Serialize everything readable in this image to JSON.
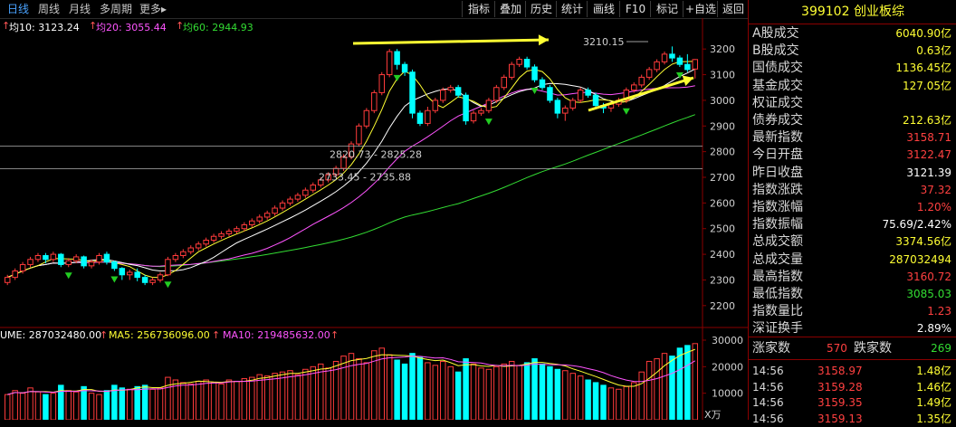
{
  "period_tabs": [
    {
      "label": "日线",
      "active": true
    },
    {
      "label": "周线",
      "active": false
    },
    {
      "label": "月线",
      "active": false
    },
    {
      "label": "多周期",
      "active": false
    },
    {
      "label": "更多▸",
      "active": false
    }
  ],
  "toolbar": [
    "指标",
    "叠加",
    "历史",
    "统计",
    "画线",
    "F10",
    "标记",
    "+自选",
    "返回"
  ],
  "ma_legend": [
    {
      "label": "均10: 3123.24",
      "color": "#ffffff"
    },
    {
      "label": "均20: 3055.44",
      "color": "#ff55ff"
    },
    {
      "label": "均60: 2944.93",
      "color": "#33dd33"
    }
  ],
  "price_axis": [
    "3200",
    "3100",
    "3000",
    "2900",
    "2800",
    "2700",
    "2600",
    "2500",
    "2400",
    "2300",
    "2200"
  ],
  "annotations": {
    "peak": "3210.15",
    "line1": "2820.73 - 2825.28",
    "line2": "2733.45 - 2735.88"
  },
  "volume_legend": [
    {
      "label": "UME: 287032480.00",
      "color": "#ffffff"
    },
    {
      "label": "MA5: 256736096.00",
      "color": "#ffff33"
    },
    {
      "label": "MA10: 219485632.00",
      "color": "#ff55ff"
    }
  ],
  "volume_axis": [
    "30000",
    "20000",
    "10000"
  ],
  "volume_unit": "X万",
  "panel": {
    "title": "399102 创业板综",
    "rows": [
      {
        "label": "A股成交",
        "value": "6040.90亿",
        "color": "#ffff33"
      },
      {
        "label": "B股成交",
        "value": "0.63亿",
        "color": "#ffff33"
      },
      {
        "label": "国债成交",
        "value": "1136.45亿",
        "color": "#ffff33"
      },
      {
        "label": "基金成交",
        "value": "127.05亿",
        "color": "#ffff33"
      },
      {
        "label": "权证成交",
        "value": "",
        "color": "#ffff33"
      },
      {
        "label": "债券成交",
        "value": "212.63亿",
        "color": "#ffff33"
      },
      {
        "label": "最新指数",
        "value": "3158.71",
        "color": "#ff4040"
      },
      {
        "label": "今日开盘",
        "value": "3122.47",
        "color": "#ff4040"
      },
      {
        "label": "昨日收盘",
        "value": "3121.39",
        "color": "#ffffff"
      },
      {
        "label": "指数涨跌",
        "value": "37.32",
        "color": "#ff4040"
      },
      {
        "label": "指数涨幅",
        "value": "1.20%",
        "color": "#ff4040"
      },
      {
        "label": "指数振幅",
        "value": "75.69/2.42%",
        "color": "#ffffff"
      },
      {
        "label": "总成交额",
        "value": "3374.56亿",
        "color": "#ffff33"
      },
      {
        "label": "总成交量",
        "value": "287032494",
        "color": "#ffff33"
      },
      {
        "label": "最高指数",
        "value": "3160.72",
        "color": "#ff4040"
      },
      {
        "label": "最低指数",
        "value": "3085.03",
        "color": "#33dd33"
      },
      {
        "label": "指数量比",
        "value": "1.23",
        "color": "#ff4040"
      },
      {
        "label": "深证换手",
        "value": "2.89%",
        "color": "#ffffff"
      }
    ],
    "breadth": {
      "up_label": "涨家数",
      "up_value": "570",
      "down_label": "跌家数",
      "down_value": "269"
    },
    "ticks": [
      {
        "time": "14:56",
        "price": "3158.97",
        "amount": "1.48亿"
      },
      {
        "time": "14:56",
        "price": "3159.28",
        "amount": "1.46亿"
      },
      {
        "time": "14:56",
        "price": "3159.35",
        "amount": "1.49亿"
      },
      {
        "time": "14:56",
        "price": "3159.13",
        "amount": "1.35亿"
      }
    ]
  },
  "colors": {
    "up": "#ff3b3b",
    "down": "#00ffff",
    "ma10": "#ffffff",
    "ma20": "#ff55ff",
    "ma60": "#33dd33",
    "vol_ma5": "#ffff33",
    "vol_ma10": "#ff55ff",
    "arrow": "#ffff33"
  },
  "chart_data": {
    "type": "candlestick",
    "ylim": [
      2150,
      3250
    ],
    "candles": [
      {
        "o": 2290,
        "c": 2310,
        "h": 2320,
        "l": 2280
      },
      {
        "o": 2310,
        "c": 2335,
        "h": 2345,
        "l": 2300
      },
      {
        "o": 2335,
        "c": 2360,
        "h": 2370,
        "l": 2325
      },
      {
        "o": 2360,
        "c": 2380,
        "h": 2390,
        "l": 2350
      },
      {
        "o": 2380,
        "c": 2395,
        "h": 2405,
        "l": 2370
      },
      {
        "o": 2395,
        "c": 2380,
        "h": 2405,
        "l": 2365
      },
      {
        "o": 2380,
        "c": 2400,
        "h": 2410,
        "l": 2370
      },
      {
        "o": 2400,
        "c": 2360,
        "h": 2405,
        "l": 2350
      },
      {
        "o": 2360,
        "c": 2375,
        "h": 2385,
        "l": 2350
      },
      {
        "o": 2375,
        "c": 2390,
        "h": 2400,
        "l": 2365
      },
      {
        "o": 2390,
        "c": 2355,
        "h": 2395,
        "l": 2345
      },
      {
        "o": 2355,
        "c": 2370,
        "h": 2380,
        "l": 2345
      },
      {
        "o": 2370,
        "c": 2395,
        "h": 2405,
        "l": 2360
      },
      {
        "o": 2400,
        "c": 2370,
        "h": 2410,
        "l": 2360
      },
      {
        "o": 2370,
        "c": 2345,
        "h": 2375,
        "l": 2335
      },
      {
        "o": 2345,
        "c": 2320,
        "h": 2350,
        "l": 2300
      },
      {
        "o": 2320,
        "c": 2330,
        "h": 2340,
        "l": 2300
      },
      {
        "o": 2330,
        "c": 2310,
        "h": 2345,
        "l": 2295
      },
      {
        "o": 2310,
        "c": 2290,
        "h": 2320,
        "l": 2280
      },
      {
        "o": 2290,
        "c": 2300,
        "h": 2310,
        "l": 2280
      },
      {
        "o": 2300,
        "c": 2320,
        "h": 2330,
        "l": 2290
      },
      {
        "o": 2320,
        "c": 2380,
        "h": 2390,
        "l": 2315
      },
      {
        "o": 2380,
        "c": 2395,
        "h": 2405,
        "l": 2370
      },
      {
        "o": 2395,
        "c": 2410,
        "h": 2420,
        "l": 2385
      },
      {
        "o": 2410,
        "c": 2425,
        "h": 2435,
        "l": 2400
      },
      {
        "o": 2425,
        "c": 2440,
        "h": 2450,
        "l": 2415
      },
      {
        "o": 2440,
        "c": 2455,
        "h": 2465,
        "l": 2430
      },
      {
        "o": 2455,
        "c": 2470,
        "h": 2480,
        "l": 2445
      },
      {
        "o": 2470,
        "c": 2480,
        "h": 2490,
        "l": 2460
      },
      {
        "o": 2480,
        "c": 2490,
        "h": 2500,
        "l": 2470
      },
      {
        "o": 2490,
        "c": 2500,
        "h": 2510,
        "l": 2480
      },
      {
        "o": 2500,
        "c": 2515,
        "h": 2525,
        "l": 2490
      },
      {
        "o": 2515,
        "c": 2530,
        "h": 2540,
        "l": 2505
      },
      {
        "o": 2530,
        "c": 2545,
        "h": 2555,
        "l": 2520
      },
      {
        "o": 2545,
        "c": 2560,
        "h": 2570,
        "l": 2535
      },
      {
        "o": 2560,
        "c": 2580,
        "h": 2590,
        "l": 2550
      },
      {
        "o": 2580,
        "c": 2600,
        "h": 2610,
        "l": 2570
      },
      {
        "o": 2600,
        "c": 2615,
        "h": 2625,
        "l": 2590
      },
      {
        "o": 2615,
        "c": 2630,
        "h": 2640,
        "l": 2605
      },
      {
        "o": 2630,
        "c": 2650,
        "h": 2660,
        "l": 2620
      },
      {
        "o": 2650,
        "c": 2670,
        "h": 2680,
        "l": 2640
      },
      {
        "o": 2670,
        "c": 2690,
        "h": 2700,
        "l": 2660
      },
      {
        "o": 2690,
        "c": 2710,
        "h": 2720,
        "l": 2680
      },
      {
        "o": 2710,
        "c": 2735,
        "h": 2745,
        "l": 2700
      },
      {
        "o": 2735,
        "c": 2780,
        "h": 2790,
        "l": 2725
      },
      {
        "o": 2780,
        "c": 2830,
        "h": 2840,
        "l": 2770
      },
      {
        "o": 2830,
        "c": 2900,
        "h": 2910,
        "l": 2820
      },
      {
        "o": 2900,
        "c": 2960,
        "h": 2970,
        "l": 2890
      },
      {
        "o": 2960,
        "c": 3030,
        "h": 3040,
        "l": 2950
      },
      {
        "o": 3030,
        "c": 3100,
        "h": 3110,
        "l": 3020
      },
      {
        "o": 3100,
        "c": 3190,
        "h": 3200,
        "l": 3090
      },
      {
        "o": 3190,
        "c": 3140,
        "h": 3200,
        "l": 3120
      },
      {
        "o": 3140,
        "c": 3110,
        "h": 3150,
        "l": 3095
      },
      {
        "o": 3110,
        "c": 2950,
        "h": 3120,
        "l": 2930
      },
      {
        "o": 2950,
        "c": 2910,
        "h": 2960,
        "l": 2900
      },
      {
        "o": 2910,
        "c": 2960,
        "h": 2975,
        "l": 2900
      },
      {
        "o": 2960,
        "c": 3000,
        "h": 3010,
        "l": 2950
      },
      {
        "o": 3000,
        "c": 3040,
        "h": 3050,
        "l": 2990
      },
      {
        "o": 3040,
        "c": 3050,
        "h": 3060,
        "l": 3030
      },
      {
        "o": 3050,
        "c": 3020,
        "h": 3060,
        "l": 3010
      },
      {
        "o": 3020,
        "c": 2920,
        "h": 3030,
        "l": 2905
      },
      {
        "o": 2920,
        "c": 2950,
        "h": 2960,
        "l": 2910
      },
      {
        "o": 2950,
        "c": 2960,
        "h": 2970,
        "l": 2940
      },
      {
        "o": 2960,
        "c": 3000,
        "h": 3010,
        "l": 2950
      },
      {
        "o": 3000,
        "c": 3050,
        "h": 3060,
        "l": 2990
      },
      {
        "o": 3050,
        "c": 3090,
        "h": 3100,
        "l": 3040
      },
      {
        "o": 3090,
        "c": 3140,
        "h": 3150,
        "l": 3080
      },
      {
        "o": 3140,
        "c": 3160,
        "h": 3170,
        "l": 3130
      },
      {
        "o": 3160,
        "c": 3130,
        "h": 3170,
        "l": 3120
      },
      {
        "o": 3130,
        "c": 3080,
        "h": 3140,
        "l": 3070
      },
      {
        "o": 3080,
        "c": 3050,
        "h": 3090,
        "l": 3040
      },
      {
        "o": 3050,
        "c": 3000,
        "h": 3060,
        "l": 2990
      },
      {
        "o": 3000,
        "c": 2950,
        "h": 3010,
        "l": 2930
      },
      {
        "o": 2950,
        "c": 2970,
        "h": 2980,
        "l": 2920
      },
      {
        "o": 2970,
        "c": 3000,
        "h": 3010,
        "l": 2960
      },
      {
        "o": 3000,
        "c": 3040,
        "h": 3050,
        "l": 2990
      },
      {
        "o": 3040,
        "c": 3020,
        "h": 3050,
        "l": 3010
      },
      {
        "o": 3020,
        "c": 2980,
        "h": 3030,
        "l": 2970
      },
      {
        "o": 2980,
        "c": 2970,
        "h": 2990,
        "l": 2950
      },
      {
        "o": 2970,
        "c": 2985,
        "h": 2995,
        "l": 2955
      },
      {
        "o": 2985,
        "c": 3000,
        "h": 3010,
        "l": 2975
      },
      {
        "o": 3000,
        "c": 3040,
        "h": 3050,
        "l": 2990
      },
      {
        "o": 3040,
        "c": 3060,
        "h": 3070,
        "l": 3030
      },
      {
        "o": 3060,
        "c": 3090,
        "h": 3100,
        "l": 3050
      },
      {
        "o": 3090,
        "c": 3120,
        "h": 3130,
        "l": 3080
      },
      {
        "o": 3120,
        "c": 3150,
        "h": 3160,
        "l": 3110
      },
      {
        "o": 3150,
        "c": 3180,
        "h": 3190,
        "l": 3140
      },
      {
        "o": 3180,
        "c": 3165,
        "h": 3210,
        "l": 3150
      },
      {
        "o": 3165,
        "c": 3140,
        "h": 3175,
        "l": 3130
      },
      {
        "o": 3140,
        "c": 3120,
        "h": 3180,
        "l": 3110
      },
      {
        "o": 3122,
        "c": 3159,
        "h": 3161,
        "l": 3085
      }
    ],
    "volume": [
      95,
      110,
      100,
      120,
      105,
      95,
      100,
      130,
      110,
      105,
      125,
      100,
      95,
      110,
      130,
      120,
      115,
      125,
      130,
      115,
      120,
      160,
      150,
      140,
      135,
      145,
      150,
      140,
      135,
      150,
      145,
      155,
      160,
      170,
      165,
      175,
      180,
      185,
      170,
      190,
      200,
      210,
      195,
      220,
      240,
      250,
      230,
      215,
      260,
      270,
      245,
      225,
      210,
      250,
      235,
      215,
      205,
      220,
      200,
      180,
      230,
      210,
      195,
      190,
      200,
      210,
      220,
      205,
      215,
      230,
      210,
      200,
      190,
      185,
      175,
      165,
      150,
      140,
      130,
      120,
      115,
      125,
      140,
      180,
      220,
      230,
      250,
      240,
      270,
      280,
      287
    ],
    "vol_ylim": [
      0,
      30000
    ]
  }
}
